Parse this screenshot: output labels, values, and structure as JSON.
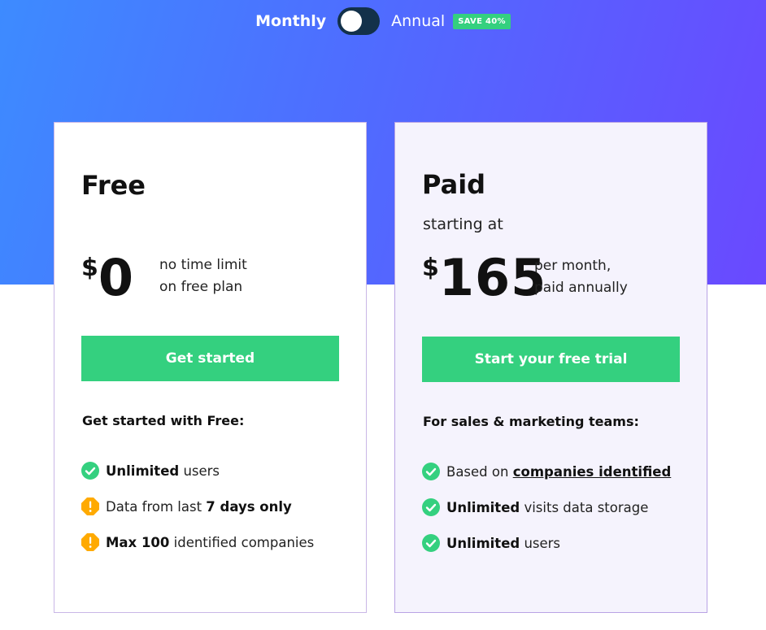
{
  "billing": {
    "monthly_label": "Monthly",
    "annual_label": "Annual",
    "save_badge": "SAVE 40%",
    "selected": "Monthly"
  },
  "colors": {
    "hero_gradient_start": "#3d8bff",
    "hero_gradient_end": "#6a49ff",
    "accent_green": "#34d07f",
    "warning_orange": "#ffaa00",
    "toggle_track": "#13314a"
  },
  "plans": [
    {
      "name": "Free",
      "currency": "$",
      "price": "0",
      "price_note_line1": "no time limit",
      "price_note_line2": "on free plan",
      "cta_label": "Get started",
      "features_title": "Get started with Free:",
      "features": [
        {
          "icon": "check-circle-icon",
          "pre": "",
          "bold": "Unlimited",
          "post": " users"
        },
        {
          "icon": "warning-octagon-icon",
          "pre": "Data from last ",
          "bold": "7 days only",
          "post": ""
        },
        {
          "icon": "warning-octagon-icon",
          "pre": "",
          "bold": "Max 100",
          "post": " identified companies"
        }
      ]
    },
    {
      "name": "Paid",
      "starting_label": "starting at",
      "currency": "$",
      "price": "165",
      "price_note_line1": "per month,",
      "price_note_line2": "paid annually",
      "cta_label": "Start your free trial",
      "features_title": "For sales & marketing teams:",
      "features": [
        {
          "icon": "check-circle-icon",
          "pre": "Based on ",
          "link": "companies identified",
          "post": ""
        },
        {
          "icon": "check-circle-icon",
          "pre": "",
          "bold": "Unlimited",
          "post": " visits data storage"
        },
        {
          "icon": "check-circle-icon",
          "pre": "",
          "bold": "Unlimited",
          "post": " users"
        }
      ]
    }
  ]
}
